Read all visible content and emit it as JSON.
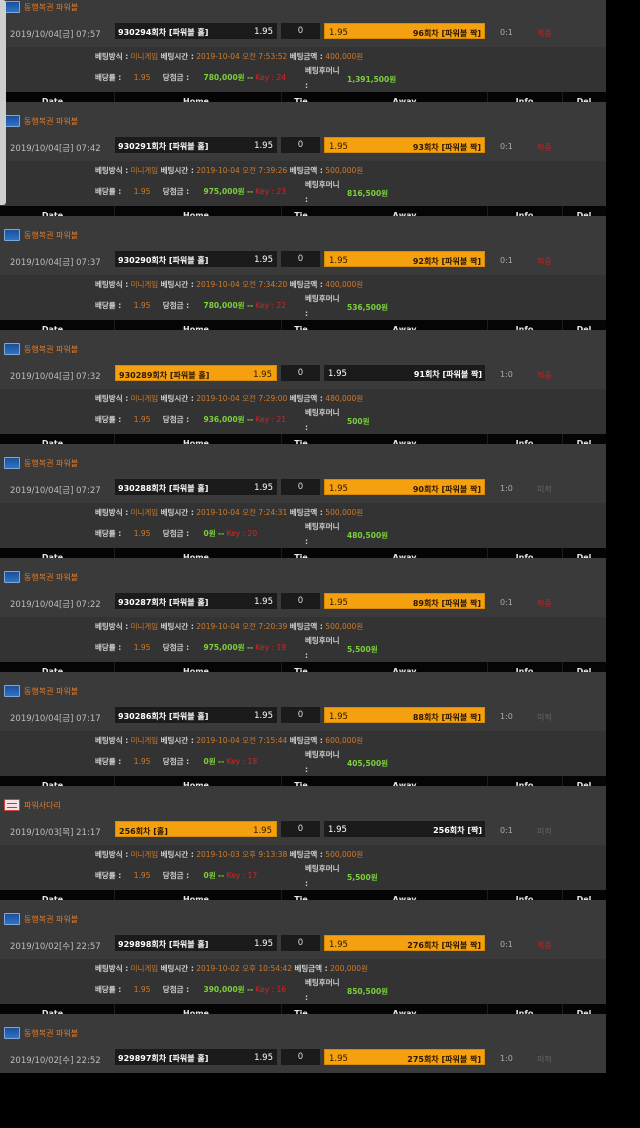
{
  "columns": {
    "date": "Date",
    "home": "Home",
    "tie": "Tie",
    "away": "Away",
    "info": "Info",
    "del": "Del"
  },
  "labels": {
    "bet_method": "베팅방식 :",
    "bet_time": "베팅시간 :",
    "bet_amount": "베팅금액 :",
    "odds": "배당률 :",
    "win_amount": "당첨금 :",
    "after_money": "베팅후머니",
    "after_colon": ":",
    "key_sep": "--",
    "key_prefix": "Key :"
  },
  "colors": {
    "selected": "#f5a10f",
    "win": "#d11c1c",
    "money": "#7bd13a",
    "orange_text": "#d07a28"
  },
  "bets": [
    {
      "game": "동행복권 파워볼",
      "icon": "powerball-icon",
      "date": "2019/10/04[금] 07:57",
      "home": "930294회차 [파워볼 홀]",
      "home_odds": "1.95",
      "tie": "0",
      "away_odds": "1.95",
      "away": "96회차 [파워볼 짝]",
      "selected": "away",
      "score": "0:1",
      "result": "적중",
      "win": true,
      "method": "미니게임",
      "time": "2019-10-04 오전 7:53:52",
      "amount": "400,000원",
      "odds": "1.95",
      "payout": "780,000원",
      "key": "24",
      "after": "1,391,500원"
    },
    {
      "game": "동행복권 파워볼",
      "icon": "powerball-icon",
      "date": "2019/10/04[금] 07:42",
      "home": "930291회차 [파워볼 홀]",
      "home_odds": "1.95",
      "tie": "0",
      "away_odds": "1.95",
      "away": "93회차 [파워볼 짝]",
      "selected": "away",
      "score": "0:1",
      "result": "적중",
      "win": true,
      "method": "미니게임",
      "time": "2019-10-04 오전 7:39:26",
      "amount": "500,000원",
      "odds": "1.95",
      "payout": "975,000원",
      "key": "23",
      "after": "816,500원"
    },
    {
      "game": "동행복권 파워볼",
      "icon": "powerball-icon",
      "date": "2019/10/04[금] 07:37",
      "home": "930290회차 [파워볼 홀]",
      "home_odds": "1.95",
      "tie": "0",
      "away_odds": "1.95",
      "away": "92회차 [파워볼 짝]",
      "selected": "away",
      "score": "0:1",
      "result": "적중",
      "win": true,
      "method": "미니게임",
      "time": "2019-10-04 오전 7:34:20",
      "amount": "400,000원",
      "odds": "1.95",
      "payout": "780,000원",
      "key": "22",
      "after": "536,500원"
    },
    {
      "game": "동행복권 파워볼",
      "icon": "powerball-icon",
      "date": "2019/10/04[금] 07:32",
      "home": "930289회차 [파워볼 홀]",
      "home_odds": "1.95",
      "tie": "0",
      "away_odds": "1.95",
      "away": "91회차 [파워볼 짝]",
      "selected": "home",
      "score": "1:0",
      "result": "적중",
      "win": true,
      "method": "미니게임",
      "time": "2019-10-04 오전 7:29:00",
      "amount": "480,000원",
      "odds": "1.95",
      "payout": "936,000원",
      "key": "21",
      "after": "500원"
    },
    {
      "game": "동행복권 파워볼",
      "icon": "powerball-icon",
      "date": "2019/10/04[금] 07:27",
      "home": "930288회차 [파워볼 홀]",
      "home_odds": "1.95",
      "tie": "0",
      "away_odds": "1.95",
      "away": "90회차 [파워볼 짝]",
      "selected": "away",
      "score": "1:0",
      "result": "미적",
      "win": false,
      "method": "미니게임",
      "time": "2019-10-04 오전 7:24:31",
      "amount": "500,000원",
      "odds": "1.95",
      "payout": "0원",
      "key": "20",
      "after": "480,500원"
    },
    {
      "game": "동행복권 파워볼",
      "icon": "powerball-icon",
      "date": "2019/10/04[금] 07:22",
      "home": "930287회차 [파워볼 홀]",
      "home_odds": "1.95",
      "tie": "0",
      "away_odds": "1.95",
      "away": "89회차 [파워볼 짝]",
      "selected": "away",
      "score": "0:1",
      "result": "적중",
      "win": true,
      "method": "미니게임",
      "time": "2019-10-04 오전 7:20:39",
      "amount": "500,000원",
      "odds": "1.95",
      "payout": "975,000원",
      "key": "19",
      "after": "5,500원"
    },
    {
      "game": "동행복권 파워볼",
      "icon": "powerball-icon",
      "date": "2019/10/04[금] 07:17",
      "home": "930286회차 [파워볼 홀]",
      "home_odds": "1.95",
      "tie": "0",
      "away_odds": "1.95",
      "away": "88회차 [파워볼 짝]",
      "selected": "away",
      "score": "1:0",
      "result": "미적",
      "win": false,
      "method": "미니게임",
      "time": "2019-10-04 오전 7:15:44",
      "amount": "600,000원",
      "odds": "1.95",
      "payout": "0원",
      "key": "18",
      "after": "405,500원"
    },
    {
      "game": "파워사다리",
      "icon": "ladder-icon",
      "date": "2019/10/03[목] 21:17",
      "home": "256회차 [홀]",
      "home_odds": "1.95",
      "tie": "0",
      "away_odds": "1.95",
      "away": "256회차 [짝]",
      "selected": "home",
      "score": "0:1",
      "result": "미적",
      "win": false,
      "method": "미니게임",
      "time": "2019-10-03 오후 9:13:38",
      "amount": "500,000원",
      "odds": "1.95",
      "payout": "0원",
      "key": "17",
      "after": "5,500원"
    },
    {
      "game": "동행복권 파워볼",
      "icon": "powerball-icon",
      "date": "2019/10/02[수] 22:57",
      "home": "929898회차 [파워볼 홀]",
      "home_odds": "1.95",
      "tie": "0",
      "away_odds": "1.95",
      "away": "276회차 [파워볼 짝]",
      "selected": "away",
      "score": "0:1",
      "result": "적중",
      "win": true,
      "method": "미니게임",
      "time": "2019-10-02 오후 10:54:42",
      "amount": "200,000원",
      "odds": "1.95",
      "payout": "390,000원",
      "key": "16",
      "after": "850,500원"
    },
    {
      "game": "동행복권 파워볼",
      "icon": "powerball-icon",
      "date": "2019/10/02[수] 22:52",
      "home": "929897회차 [파워볼 홀]",
      "home_odds": "1.95",
      "tie": "0",
      "away_odds": "1.95",
      "away": "275회차 [파워볼 짝]",
      "selected": "away",
      "score": "1:0",
      "result": "미적",
      "win": false
    }
  ]
}
